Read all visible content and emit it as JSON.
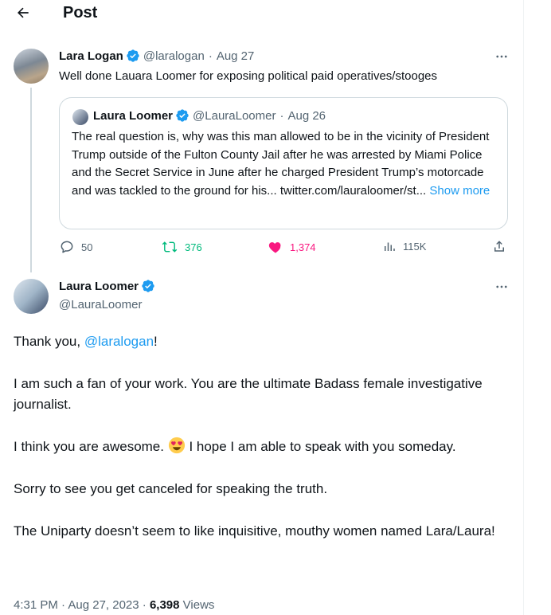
{
  "header": {
    "title": "Post",
    "back_icon": "arrow-left-icon"
  },
  "quoted_parent": {
    "author_name": "Lara Logan",
    "handle": "@laralogan",
    "date": "Aug 27",
    "sep": "·",
    "text": "Well done Lauara Loomer for exposing political paid operatives/stooges",
    "quote": {
      "author_name": "Laura Loomer",
      "handle": "@LauraLoomer",
      "date": "Aug 26",
      "sep": "·",
      "text": "The real question is, why was this man allowed to be in the vicinity of President Trump outside of the Fulton County Jail after he was arrested by Miami Police and the Secret Service in June after he charged President Trump’s motorcade and was tackled to the ground for his... twitter.com/lauraloomer/st...",
      "show_more": "Show more"
    },
    "actions": {
      "replies": "50",
      "reposts": "376",
      "likes": "1,374",
      "views": "115K"
    }
  },
  "main_post": {
    "author_name": "Laura Loomer",
    "handle": "@LauraLoomer",
    "p1_pre": "Thank you, ",
    "p1_mention": "@laralogan",
    "p1_post": "!",
    "p2": "I am such a fan of your work. You are the ultimate Badass female investigative journalist.",
    "p3_pre": "I think you are awesome. ",
    "p3_post": " I hope I am able to speak with you someday.",
    "p4": "Sorry to see you get canceled for speaking the truth.",
    "p5": "The Uniparty doesn’t seem to like inquisitive, mouthy women named Lara/Laura!",
    "timestamp": "4:31 PM · Aug 27, 2023 · ",
    "views_count": "6,398",
    "views_label": " Views"
  },
  "colors": {
    "accent": "#1d9bf0",
    "repost": "#00ba7c",
    "like": "#f91880",
    "muted": "#536471",
    "text": "#0f1419"
  }
}
